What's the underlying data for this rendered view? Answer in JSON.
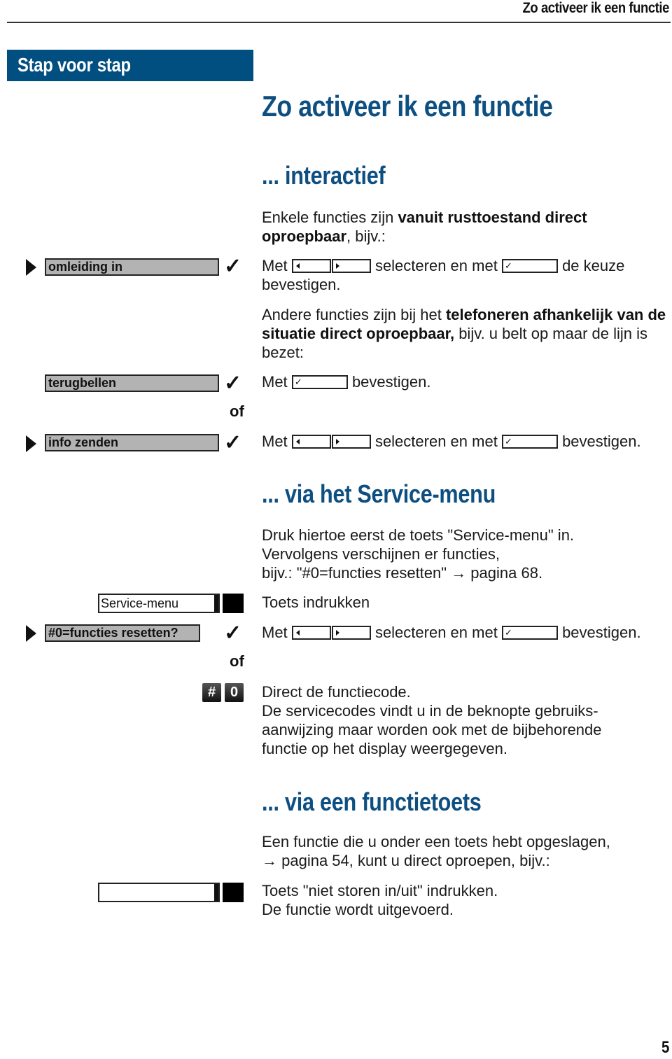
{
  "header": {
    "running_title": "Zo activeer ik een functie",
    "sidebar_label": "Stap voor stap"
  },
  "page_title": "Zo activeer ik een functie",
  "sections": {
    "interactief": {
      "heading": "... interactief",
      "intro_pre": "Enkele functies zijn ",
      "intro_bold": "vanuit rusttoestand direct oproepbaar",
      "intro_post": ", bijv.:",
      "step1": {
        "display": "omleiding in",
        "text_met": "Met",
        "text_select": "selecteren en met",
        "text_end": "de keuze bevestigen."
      },
      "other_pre": "Andere functies zijn bij het ",
      "other_bold": "telefoneren afhankelijk van de situatie direct oproepbaar,",
      "other_post": " bijv. u belt op maar de lijn is bezet:",
      "step2": {
        "display": "terugbellen",
        "text_met": "Met",
        "text_end": "bevestigen."
      },
      "or_label": "of",
      "step3": {
        "display": "info zenden",
        "text_met": "Met",
        "text_select": "selecteren en met",
        "text_end": "bevestigen."
      }
    },
    "service_menu": {
      "heading": "... via het Service-menu",
      "intro": "Druk hiertoe eerst de toets \"Service-menu\" in.\nVervolgens verschijnen er functies,\nbijv.: \"#0=functies resetten\" → pagina 68.",
      "key_label": "Service-menu",
      "key_text": "Toets indrukken",
      "step": {
        "display": "#0=functies resetten?",
        "text_met": "Met",
        "text_select": "selecteren en met",
        "text_end": "bevestigen."
      },
      "or_label": "of",
      "code_keys": [
        "#",
        "0"
      ],
      "code_text": "Direct de functiecode.\nDe servicecodes vindt u in de beknopte gebruiks-\naanwijzing maar worden ook met de bijbehorende\nfunctie op het display weergegeven."
    },
    "functietoets": {
      "heading": "... via een functietoets",
      "intro": "Een functie die u onder een toets hebt opgeslagen,\n→ pagina 54, kunt u direct oproepen, bijv.:",
      "key_label": "",
      "key_text": "Toets \"niet storen in/uit\" indrukken.\nDe functie wordt uitgevoerd."
    }
  },
  "icons": {
    "check": "✓",
    "check_small": "✓",
    "arrow_right": "→"
  },
  "page_number": "5",
  "colors": {
    "brand_blue": "#004f80",
    "heading_blue": "#0e4f82",
    "display_gray": "#b3b3b3"
  }
}
